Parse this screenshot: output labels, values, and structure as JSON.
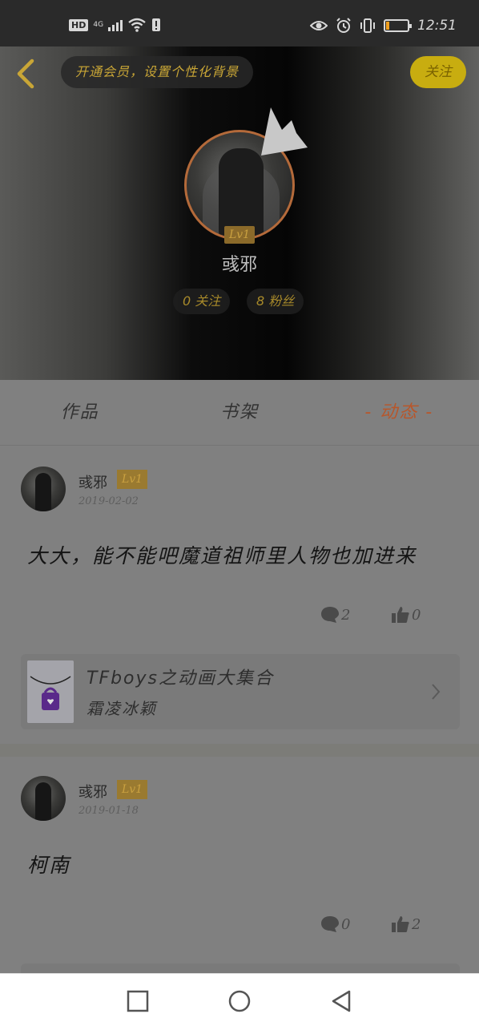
{
  "status_bar": {
    "hd": "HD",
    "network": "4G",
    "time": "12:51",
    "battery_level": 0.15,
    "battery_color": "#f0a020"
  },
  "header": {
    "back_icon": "chevron-left-icon",
    "vip_prompt": "开通会员，设置个性化背景",
    "follow_button": "关注",
    "level": "Lv1",
    "username": "彧邪",
    "following": "0 关注",
    "followers": "8 粉丝",
    "accent": "#c8ad10"
  },
  "tabs": [
    {
      "label": "作品",
      "active": false
    },
    {
      "label": "书架",
      "active": false
    },
    {
      "label": "- 动态 -",
      "active": true
    }
  ],
  "posts": [
    {
      "username": "彧邪",
      "level": "Lv1",
      "date": "2019-02-02",
      "text": "大大，能不能吧魔道祖师里人物也加进来",
      "comments": "2",
      "likes": "0",
      "book": {
        "title": "TFboys之动画大集合",
        "author": "霜凌冰颖"
      }
    },
    {
      "username": "彧邪",
      "level": "Lv1",
      "date": "2019-01-18",
      "text": "柯南",
      "comments": "0",
      "likes": "2"
    }
  ],
  "navbar": {
    "items": [
      "recent-apps-icon",
      "home-icon",
      "back-icon"
    ]
  }
}
